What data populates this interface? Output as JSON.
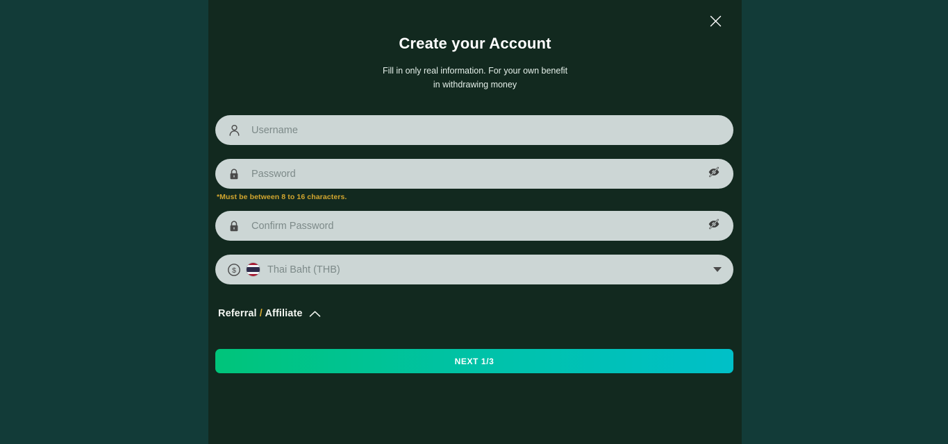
{
  "theme": {
    "page_background": "#123b38",
    "modal_background": "#12291f",
    "field_background": "#ccd6d5",
    "placeholder_color": "#7d8a89",
    "accent_gold": "#d2a62f",
    "button_gradient_start": "#00c47a",
    "button_gradient_end": "#00c0c8",
    "text_light": "#ffffff"
  },
  "modal": {
    "title": "Create your Account",
    "subtitle_line1": "Fill in only real information. For your own benefit",
    "subtitle_line2": "in withdrawing money",
    "close_icon": "close-icon"
  },
  "form": {
    "username": {
      "icon": "person-icon",
      "placeholder": "Username",
      "value": ""
    },
    "password": {
      "icon": "lock-icon",
      "placeholder": "Password",
      "value": "",
      "toggle_icon": "eye-off-icon",
      "hint": "*Must be between 8 to 16 characters."
    },
    "confirm_password": {
      "icon": "lock-icon",
      "placeholder": "Confirm Password",
      "value": "",
      "toggle_icon": "eye-off-icon"
    },
    "currency": {
      "icon": "dollar-circle-icon",
      "flag": "thailand-flag-icon",
      "selected": "Thai Baht (THB)",
      "caret_icon": "chevron-down-icon"
    }
  },
  "referral": {
    "label_part1": "Referral",
    "separator": "/",
    "label_part2": "Affiliate",
    "toggle_icon": "chevron-up-icon"
  },
  "actions": {
    "next_label": "NEXT 1/3"
  }
}
